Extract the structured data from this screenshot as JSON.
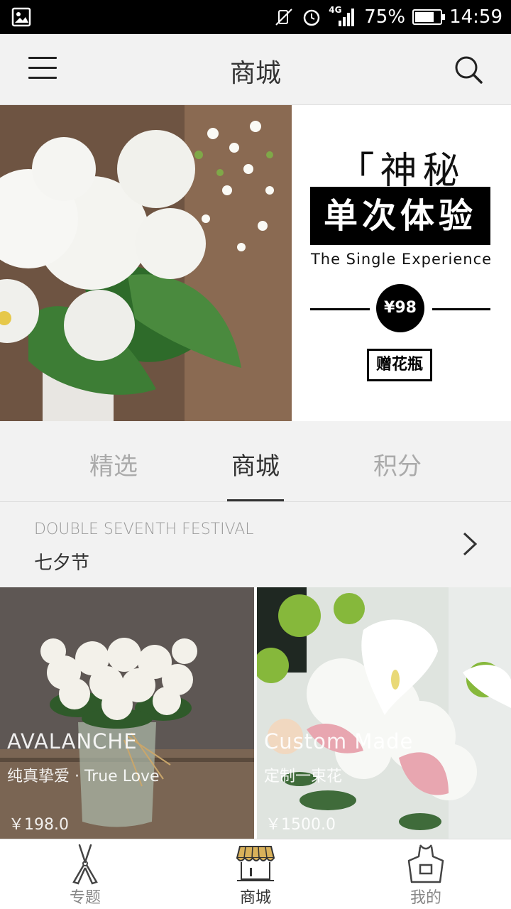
{
  "status_bar": {
    "battery": "75%",
    "battery_level": 0.75,
    "network": "4G",
    "time": "14:59"
  },
  "header": {
    "title": "商城",
    "menu_icon": "hamburger-menu-icon",
    "search_icon": "search-icon"
  },
  "banner": {
    "heading": "「神秘箱」",
    "box_text": "单次体验",
    "subtitle": "The Single Experience",
    "price": "¥98",
    "gift": "赠花瓶"
  },
  "tabs": [
    {
      "label": "精选",
      "active": false
    },
    {
      "label": "商城",
      "active": true
    },
    {
      "label": "积分",
      "active": false
    }
  ],
  "section": {
    "title_en": "DOUBLE SEVENTH FESTIVAL",
    "title_zh": "七夕节"
  },
  "products": [
    {
      "title": "AVALANCHE",
      "subtitle": "纯真挚爱 · True Love",
      "price": "￥198.0"
    },
    {
      "title": "Custom Made",
      "subtitle": "定制一束花",
      "price": "￥1500.0"
    }
  ],
  "bottom_nav": [
    {
      "label": "专题",
      "icon": "pruning-shears-icon",
      "active": false
    },
    {
      "label": "商城",
      "icon": "shop-awning-icon",
      "active": true
    },
    {
      "label": "我的",
      "icon": "apron-icon",
      "active": false
    }
  ],
  "colors": {
    "accent_awning": "#d9b15a",
    "text_primary": "#333333",
    "text_muted": "#aaaaaa"
  }
}
